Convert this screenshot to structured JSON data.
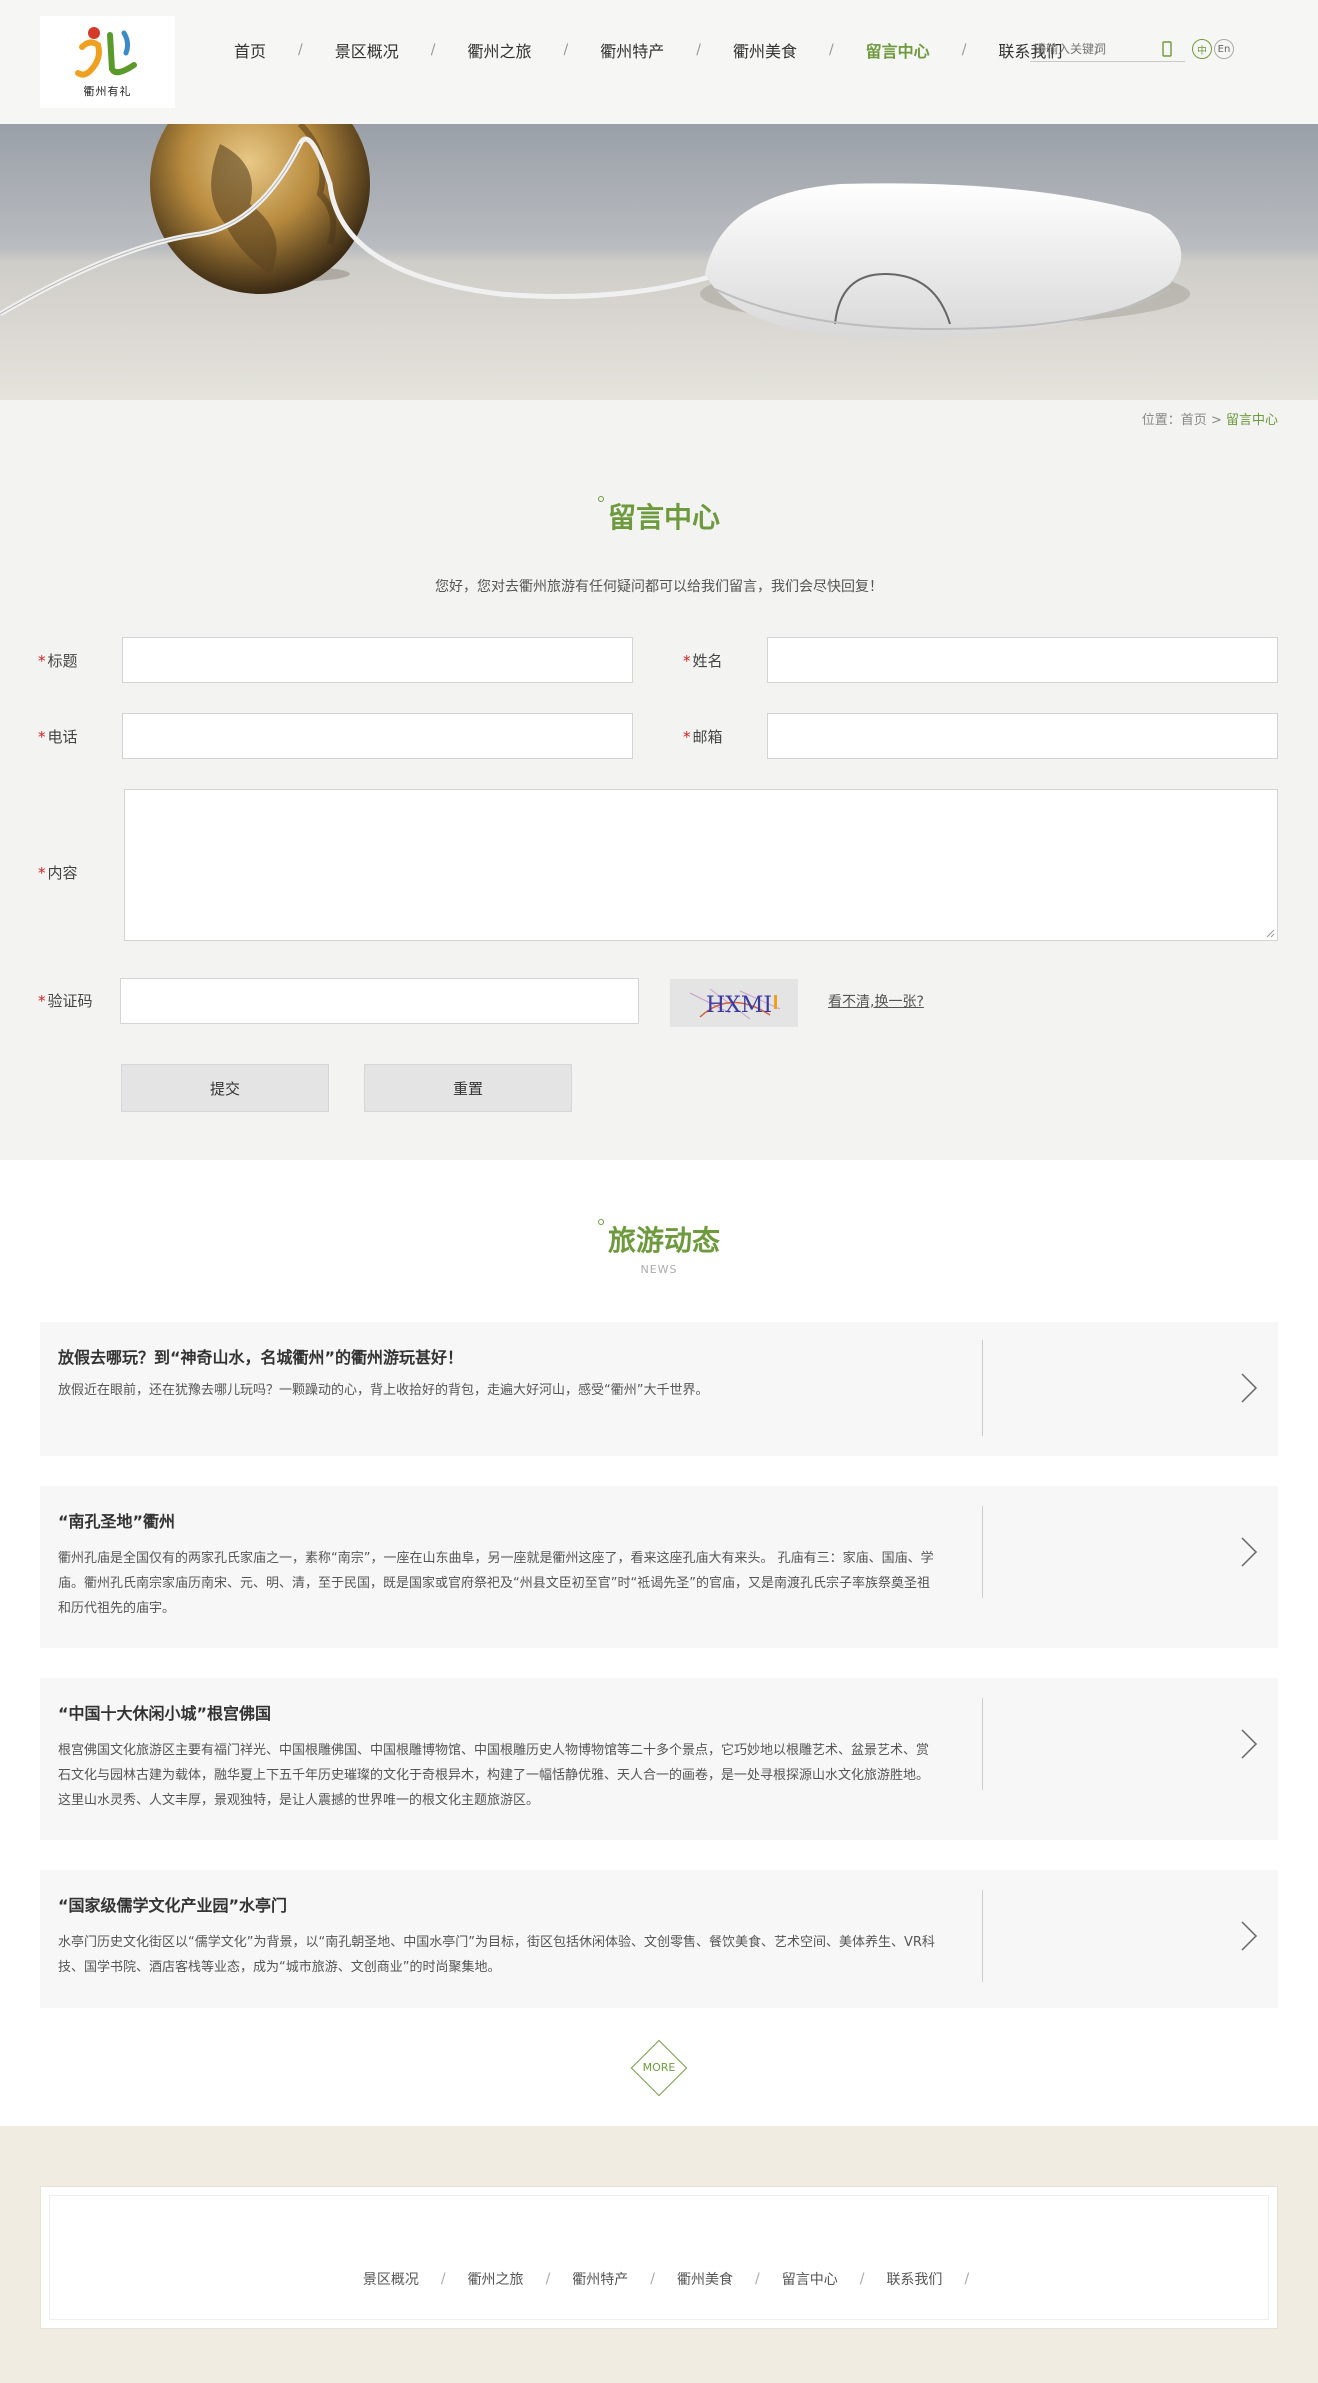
{
  "header": {
    "logo_text": "衢州有礼",
    "nav": [
      {
        "label": "首页",
        "active": false
      },
      {
        "label": "景区概况",
        "active": false
      },
      {
        "label": "衢州之旅",
        "active": false
      },
      {
        "label": "衢州特产",
        "active": false
      },
      {
        "label": "衢州美食",
        "active": false
      },
      {
        "label": "留言中心",
        "active": true
      },
      {
        "label": "联系我们",
        "active": false
      }
    ],
    "nav_separator": "/",
    "search_placeholder": "请输入关键词",
    "lang_cn": "中",
    "lang_en": "En"
  },
  "breadcrumb": {
    "prefix": "位置：",
    "home": "首页",
    "sep": ">",
    "current": "留言中心"
  },
  "message": {
    "title": "留言中心",
    "intro": "您好，您对去衢州旅游有任何疑问都可以给我们留言，我们会尽快回复！",
    "required_mark": "*",
    "fields": {
      "title": "标题",
      "name": "姓名",
      "phone": "电话",
      "email": "邮箱",
      "content": "内容",
      "captcha": "验证码"
    },
    "captcha_text": "HXMI",
    "refresh_label": "看不清,换一张?",
    "submit_label": "提交",
    "reset_label": "重置"
  },
  "news": {
    "title": "旅游动态",
    "subtitle": "NEWS",
    "items": [
      {
        "title": "放假去哪玩？到“神奇山水，名城衢州”的衢州游玩甚好！",
        "body": "放假近在眼前，还在犹豫去哪儿玩吗？一颗躁动的心，背上收拾好的背包，走遍大好河山，感受“衢州”大千世界。"
      },
      {
        "title": "“南孔圣地”衢州",
        "body": "衢州孔庙是全国仅有的两家孔氏家庙之一，素称“南宗”，一座在山东曲阜，另一座就是衢州这座了，看来这座孔庙大有来头。 孔庙有三：家庙、国庙、学庙。衢州孔氏南宗家庙历南宋、元、明、清，至于民国，既是国家或官府祭祀及“州县文臣初至官”时“祗谒先圣”的官庙，又是南渡孔氏宗子率族祭奠圣祖和历代祖先的庙宇。"
      },
      {
        "title": "“中国十大休闲小城”根宫佛国",
        "body": "根宫佛国文化旅游区主要有福门祥光、中国根雕佛国、中国根雕博物馆、中国根雕历史人物博物馆等二十多个景点，它巧妙地以根雕艺术、盆景艺术、赏石文化与园林古建为载体，融华夏上下五千年历史璀璨的文化于奇根异木，构建了一幅恬静优雅、天人合一的画卷，是一处寻根探源山水文化旅游胜地。 这里山水灵秀、人文丰厚，景观独特，是让人震撼的世界唯一的根文化主题旅游区。"
      },
      {
        "title": "“国家级儒学文化产业园”水亭门",
        "body": "水亭门历史文化街区以“儒学文化”为背景，以“南孔朝圣地、中国水亭门”为目标，街区包括休闲体验、文创零售、餐饮美食、艺术空间、美体养生、VR科技、国学书院、酒店客栈等业态，成为“城市旅游、文创商业”的时尚聚集地。"
      }
    ],
    "more_label": "MORE"
  },
  "footer": {
    "links": [
      "景区概况",
      "衢州之旅",
      "衢州特产",
      "衢州美食",
      "留言中心",
      "联系我们"
    ],
    "separator": "/"
  },
  "colors": {
    "accent": "#6e9a3e",
    "required": "#cc2222"
  }
}
